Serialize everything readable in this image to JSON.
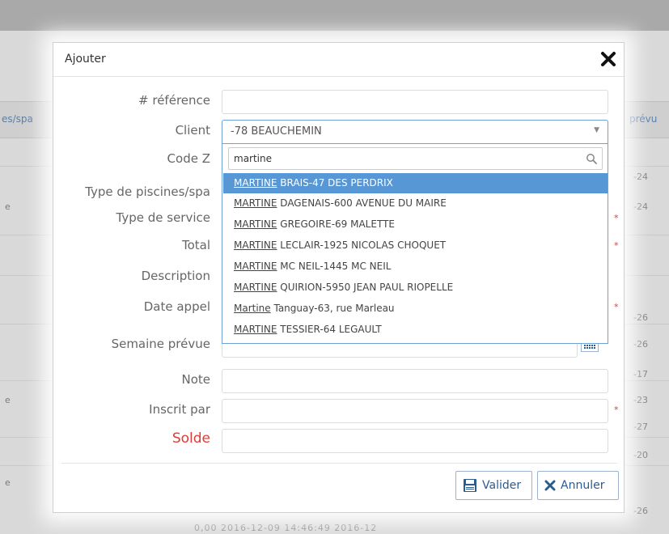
{
  "modal": {
    "title": "Ajouter",
    "labels": {
      "reference": "# référence",
      "client": "Client",
      "code_z": "Code Z",
      "type_piscine": "Type de piscines/spa",
      "type_service": "Type de service",
      "total": "Total",
      "description": "Description",
      "date_appel": "Date appel",
      "semaine_prevue": "Semaine prévue",
      "note": "Note",
      "inscrit_par": "Inscrit par",
      "solde": "Solde"
    },
    "required_mark": "*",
    "buttons": {
      "valider": "Valider",
      "annuler": "Annuler"
    }
  },
  "client_select": {
    "selected_value": "-78 BEAUCHEMIN",
    "search_value": "martine",
    "options": [
      {
        "match": "MARTINE",
        "rest": " BRAIS-47 DES PERDRIX",
        "selected": true
      },
      {
        "match": "MARTINE",
        "rest": " DAGENAIS-600 AVENUE DU MAIRE",
        "selected": false
      },
      {
        "match": "MARTINE",
        "rest": " GREGOIRE-69 MALETTE",
        "selected": false
      },
      {
        "match": "MARTINE",
        "rest": " LECLAIR-1925 NICOLAS CHOQUET",
        "selected": false
      },
      {
        "match": "MARTINE",
        "rest": " MC NEIL-1445 MC NEIL",
        "selected": false
      },
      {
        "match": "MARTINE",
        "rest": " QUIRION-5950 JEAN PAUL RIOPELLE",
        "selected": false
      },
      {
        "match": "Martine",
        "rest": " Tanguay-63, rue Marleau",
        "selected": false
      },
      {
        "match": "MARTINE",
        "rest": " TESSIER-64 LEGAULT",
        "selected": false
      }
    ]
  },
  "background": {
    "col_left": "es/spa",
    "col_right": "prévu",
    "right_numbers": [
      "-24",
      "-24",
      "-26",
      "-26",
      "-17",
      "-23",
      "-27",
      "-20",
      "-26"
    ],
    "left_marks": [
      "e",
      "e",
      "e"
    ],
    "bottom_text": "0,00                    2016-12-09 14:46:49        2016-12"
  },
  "colors": {
    "accent": "#5897d6",
    "button_text": "#2c5c8f",
    "required": "#e53935"
  }
}
